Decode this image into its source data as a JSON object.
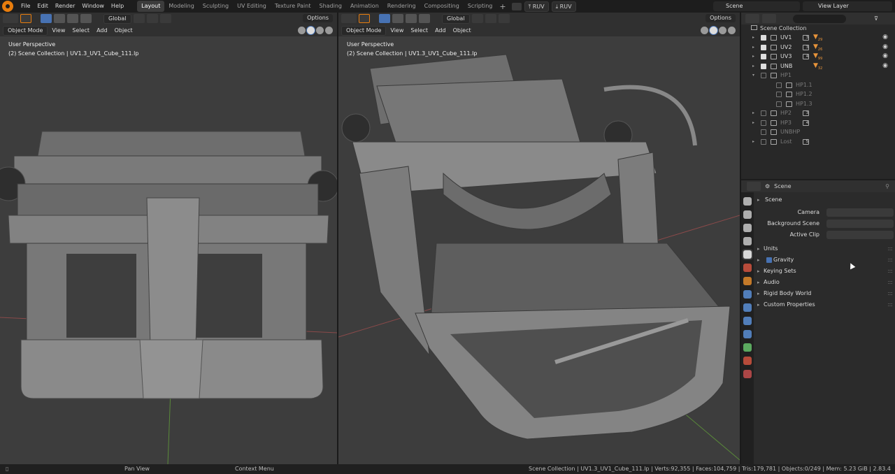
{
  "menu": [
    "File",
    "Edit",
    "Render",
    "Window",
    "Help"
  ],
  "workspaces": [
    "Layout",
    "Modeling",
    "Sculpting",
    "UV Editing",
    "Texture Paint",
    "Shading",
    "Animation",
    "Rendering",
    "Compositing",
    "Scripting"
  ],
  "active_workspace": "Layout",
  "plus": "+",
  "render_buttons": [
    "RUV",
    "RUV"
  ],
  "scene_name": "Scene",
  "view_layer": "View Layer",
  "viewport_left": {
    "mode": "Object Mode",
    "menus": [
      "View",
      "Select",
      "Add",
      "Object"
    ],
    "orientation": "Global",
    "options": "Options",
    "perspective": "User Perspective",
    "collection_info": "(2) Scene Collection | UV1.3_UV1_Cube_111.lp"
  },
  "viewport_right": {
    "mode": "Object Mode",
    "menus": [
      "View",
      "Select",
      "Add",
      "Object"
    ],
    "orientation": "Global",
    "options": "Options",
    "perspective": "User Perspective",
    "collection_info": "(2) Scene Collection | UV1.3_UV1_Cube_111.lp"
  },
  "outliner": {
    "root": "Scene Collection",
    "rows": [
      {
        "name": "UV1",
        "checked": true,
        "badge": "3",
        "tri": "29",
        "dim": false,
        "eye": true,
        "level": 1,
        "arrow": "▸"
      },
      {
        "name": "UV2",
        "checked": true,
        "badge": "3",
        "tri": "26",
        "dim": false,
        "eye": true,
        "level": 1,
        "arrow": "▸"
      },
      {
        "name": "UV3",
        "checked": true,
        "badge": "4",
        "tri": "99",
        "dim": false,
        "eye": true,
        "level": 1,
        "arrow": "▸"
      },
      {
        "name": "UNB",
        "checked": true,
        "badge": "",
        "tri": "32",
        "dim": false,
        "eye": true,
        "level": 1,
        "arrow": "▸"
      },
      {
        "name": "HP1",
        "checked": false,
        "badge": "",
        "tri": "",
        "dim": true,
        "eye": false,
        "level": 1,
        "arrow": "▾"
      },
      {
        "name": "HP1.1",
        "checked": false,
        "badge": "",
        "tri": "",
        "dim": true,
        "eye": false,
        "level": 2,
        "arrow": ""
      },
      {
        "name": "HP1.2",
        "checked": false,
        "badge": "",
        "tri": "",
        "dim": true,
        "eye": false,
        "level": 2,
        "arrow": ""
      },
      {
        "name": "HP1.3",
        "checked": false,
        "badge": "",
        "tri": "",
        "dim": true,
        "eye": false,
        "level": 2,
        "arrow": ""
      },
      {
        "name": "HP2",
        "checked": false,
        "badge": "3",
        "tri": "",
        "dim": true,
        "eye": false,
        "level": 1,
        "arrow": "▸"
      },
      {
        "name": "HP3",
        "checked": false,
        "badge": "4",
        "tri": "",
        "dim": true,
        "eye": false,
        "level": 1,
        "arrow": "▸"
      },
      {
        "name": "UNBHP",
        "checked": false,
        "badge": "",
        "tri": "",
        "dim": true,
        "eye": false,
        "level": 1,
        "arrow": ""
      },
      {
        "name": "Lost",
        "checked": false,
        "badge": "5",
        "tri": "",
        "dim": true,
        "eye": false,
        "level": 1,
        "arrow": "▸"
      }
    ]
  },
  "properties": {
    "header": "Scene",
    "section": "Scene",
    "fields": [
      {
        "label": "Camera"
      },
      {
        "label": "Background Scene"
      },
      {
        "label": "Active Clip"
      }
    ],
    "subsections": [
      "Units",
      "Gravity",
      "Keying Sets",
      "Audio",
      "Rigid Body World",
      "Custom Properties"
    ],
    "gravity_checked": true,
    "tab_colors": [
      "#c8c8c8",
      "#c8c8c8",
      "#c8c8c8",
      "#c8c8c8",
      "#d9d9d9",
      "#d2533f",
      "#e08a2c",
      "#5b8fd6",
      "#5b8fd6",
      "#5b8fd6",
      "#5b8fd6",
      "#66c26b",
      "#d2533f",
      "#c44d4d"
    ]
  },
  "statusbar": {
    "left": "Pan View",
    "middle": "Context Menu",
    "right": "Scene Collection | UV1.3_UV1_Cube_111.lp | Verts:92,355 | Faces:104,759 | Tris:179,781 | Objects:0/249 | Mem: 5.23 GiB | 2.83.4"
  },
  "colors": {
    "accent": "#4772b3",
    "object_orange": "#e8943a",
    "viewport_bg": "#3d3d3d"
  }
}
